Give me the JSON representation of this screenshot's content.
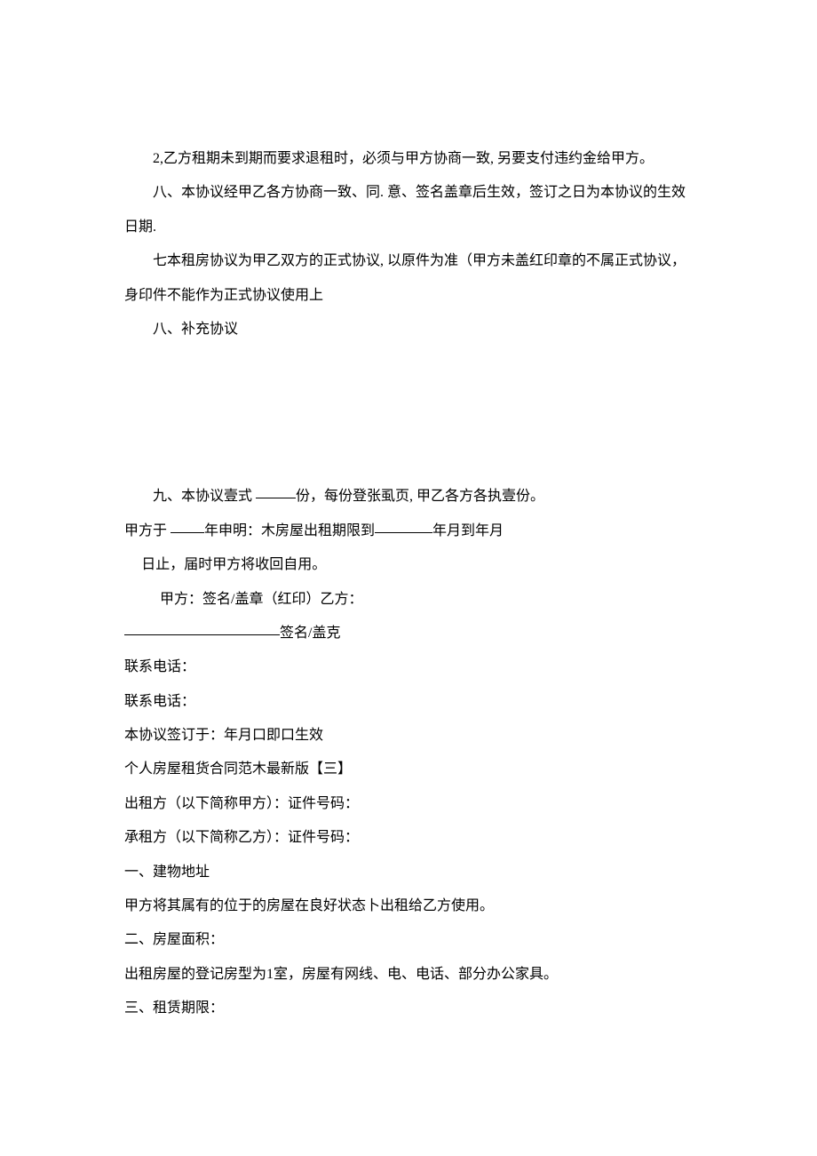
{
  "p1": "2,乙方租期未到期而要求退租时，必须与甲方协商一致, 另要支付违约金给甲方。",
  "p2": "八、本协议经甲乙各方协商一致、同. 意、签名盖章后生效，签订之日为本协议的生效日期.",
  "p3": "七本租房协议为甲乙双方的正式协议, 以原件为准（甲方未盖红印章的不属正式协议，身印件不能作为正式协议使用上",
  "p4": "八、补充协议",
  "p5a": "九、本协议壹式 ",
  "p5b": "份，每份登张虱页, 甲乙各方各执壹份。",
  "p6a": "甲方于 ",
  "p6b": "年申明：木房屋出租期限到",
  "p6c": "年月到年月",
  "p7": "日止，届时甲方将收回自用。",
  "p8": "甲方：签名/盖章（红印）乙方：",
  "p9": "签名/盖克",
  "p10": "联系电话：",
  "p11": "联系电话：",
  "p12": "本协议签订于：年月口即口生效",
  "p13": "个人房屋租货合同范木最新版【三】",
  "p14": "出租方（以下简称甲方）：证件号码：",
  "p15": "承租方（以下简称乙方）：证件号码：",
  "p16": "一、建物地址",
  "p17": "甲方将其属有的位于的房屋在良好状态卜出租给乙方使用。",
  "p18": "二、房屋面积：",
  "p19": "出租房屋的登记房型为1室，房屋有网线、电、电话、部分办公家具。",
  "p20": "三、租赁期限："
}
